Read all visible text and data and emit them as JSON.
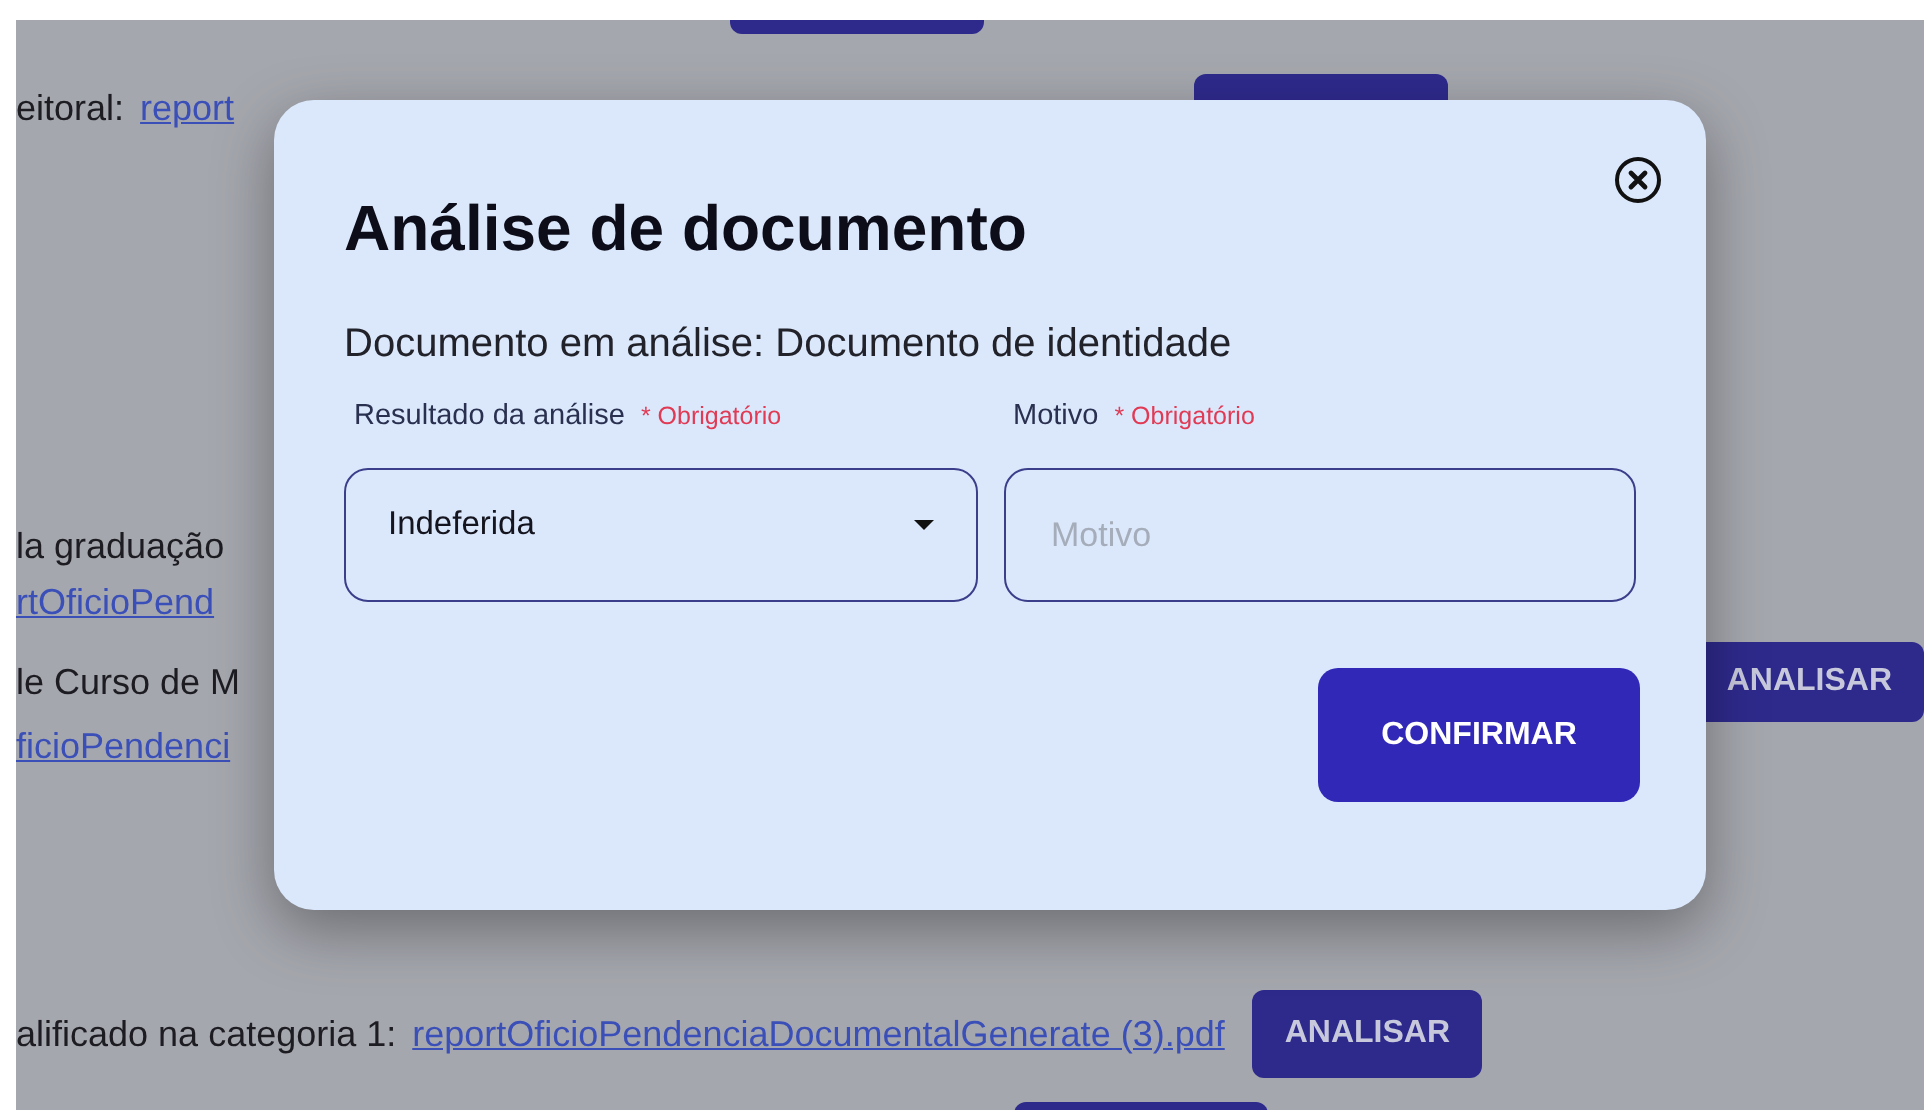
{
  "background": {
    "rows": [
      {
        "kind": "button_only"
      },
      {
        "kind": "line",
        "text": "eitoral:",
        "link": "report",
        "button": ""
      },
      {
        "kind": "text",
        "text": "la graduação"
      },
      {
        "kind": "link",
        "link": "rtOficioPend"
      },
      {
        "kind": "line",
        "text": "le Curso de M",
        "button": "ANALISAR"
      },
      {
        "kind": "link",
        "link": "ficioPendenci"
      },
      {
        "kind": "line",
        "text": "alificado na categoria 1:",
        "link": "reportOficioPendenciaDocumentalGenerate (3).pdf",
        "button": "ANALISAR"
      },
      {
        "kind": "button_only"
      }
    ]
  },
  "modal": {
    "title": "Análise de documento",
    "subtitle": "Documento em análise: Documento de identidade",
    "fields": [
      {
        "kind": "select",
        "label": "Resultado da análise",
        "required": "* Obrigatório",
        "value": "Indeferida"
      },
      {
        "kind": "input",
        "label": "Motivo",
        "required": "* Obrigatório",
        "placeholder": "Motivo"
      }
    ],
    "confirm": "CONFIRMAR"
  }
}
